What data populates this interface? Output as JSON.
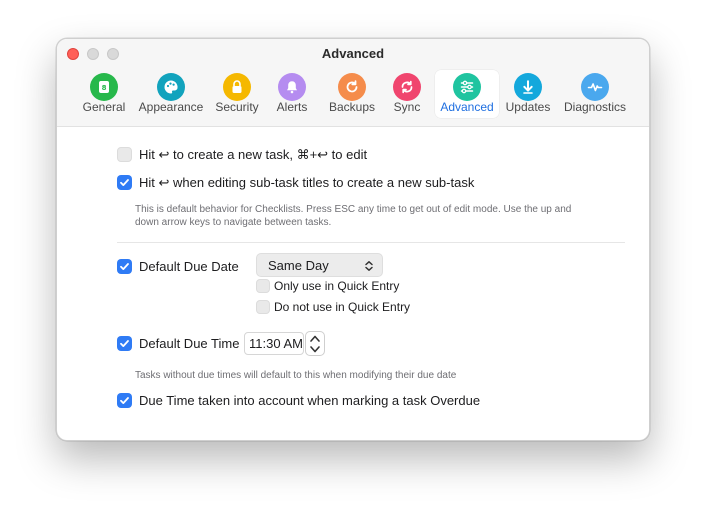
{
  "window": {
    "title": "Advanced"
  },
  "tabs": [
    {
      "label": "General",
      "icon": "general-icon",
      "color": "#27b84b"
    },
    {
      "label": "Appearance",
      "icon": "palette-icon",
      "color": "#12a3bd"
    },
    {
      "label": "Security",
      "icon": "lock-icon",
      "color": "#f5b800"
    },
    {
      "label": "Alerts",
      "icon": "bell-icon",
      "color": "#b58cf0"
    },
    {
      "label": "Backups",
      "icon": "backup-icon",
      "color": "#f58c4b"
    },
    {
      "label": "Sync",
      "icon": "sync-icon",
      "color": "#f0456e"
    },
    {
      "label": "Advanced",
      "icon": "sliders-icon",
      "color": "#1fc4a0",
      "active": true
    },
    {
      "label": "Updates",
      "icon": "download-icon",
      "color": "#14a8dc"
    },
    {
      "label": "Diagnostics",
      "icon": "pulse-icon",
      "color": "#4aa8ee"
    }
  ],
  "settings": {
    "hit_return_new_task": {
      "label": "Hit ↩ to create a new task, ⌘+↩ to edit",
      "checked": false
    },
    "hit_return_subtask": {
      "label": "Hit ↩ when editing sub-task titles to create a new sub-task",
      "checked": true,
      "note_line1": "This is default behavior for Checklists. Press ESC any time to get out of edit mode. Use the up and",
      "note_line2": "down arrow keys to navigate between tasks."
    },
    "default_due_date": {
      "label": "Default Due Date",
      "checked": true,
      "selected": "Same Day",
      "option_quick_only": "Only use in Quick Entry",
      "option_quick_not": "Do not use in Quick Entry"
    },
    "default_due_time": {
      "label": "Default Due Time",
      "checked": true,
      "value": "11:30 AM",
      "note": "Tasks without due times will default to this when modifying their due date"
    },
    "due_time_overdue": {
      "label": "Due Time taken into account when marking a task Overdue",
      "checked": true
    }
  },
  "colors": {
    "accent": "#2f7bf5",
    "close": "#ff5f57"
  }
}
